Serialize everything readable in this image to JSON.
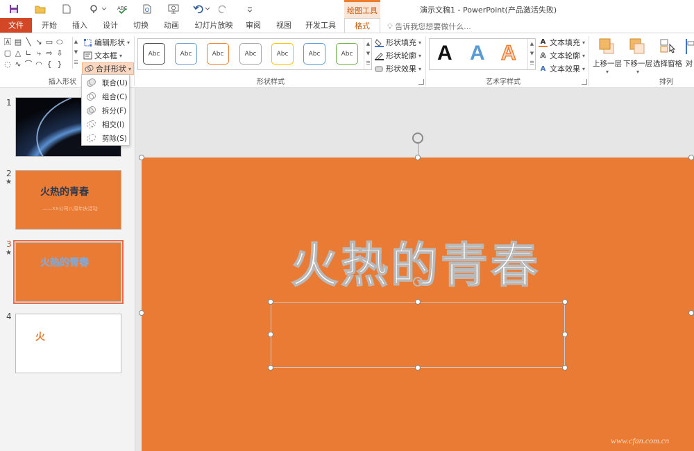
{
  "titlebar": {
    "doc_title": "演示文稿1 - PowerPoint(产品激活失败)",
    "contextual_label": "绘图工具"
  },
  "tabs": [
    "文件",
    "开始",
    "插入",
    "设计",
    "切换",
    "动画",
    "幻灯片放映",
    "审阅",
    "视图",
    "开发工具",
    "格式"
  ],
  "tell_me": "告诉我您想要做什么...",
  "insert_shapes": {
    "edit_shape": "编辑形状",
    "text_box": "文本框",
    "merge_shapes": "合并形状",
    "group_label": "插入形状"
  },
  "merge_menu": {
    "items": [
      "联合(U)",
      "组合(C)",
      "拆分(F)",
      "相交(I)",
      "剪除(S)"
    ]
  },
  "shape_styles": {
    "preview_text": "Abc",
    "fill": "形状填充",
    "outline": "形状轮廓",
    "effects": "形状效果",
    "group_label": "形状样式"
  },
  "wordart": {
    "letter": "A",
    "text_fill": "文本填充",
    "text_outline": "文本轮廓",
    "text_effects": "文本效果",
    "group_label": "艺术字样式"
  },
  "arrange": {
    "bring_forward": "上移一层",
    "send_backward": "下移一层",
    "selection_pane": "选择窗格",
    "align_partial": "对",
    "group_label": "排列"
  },
  "slides": [
    {
      "num": "1"
    },
    {
      "num": "2",
      "title": "火热的青春",
      "subtitle": "——XX公司八周年庆活动"
    },
    {
      "num": "3",
      "title": "火热的青春"
    },
    {
      "num": "4",
      "title": "火"
    }
  ],
  "main_slide": {
    "title": "火热的青春"
  },
  "watermark": "www.cfan.com.cn",
  "colors": {
    "accent": "#d24726",
    "slide_bg": "#ea7b34",
    "contextual": "#c55a11"
  }
}
